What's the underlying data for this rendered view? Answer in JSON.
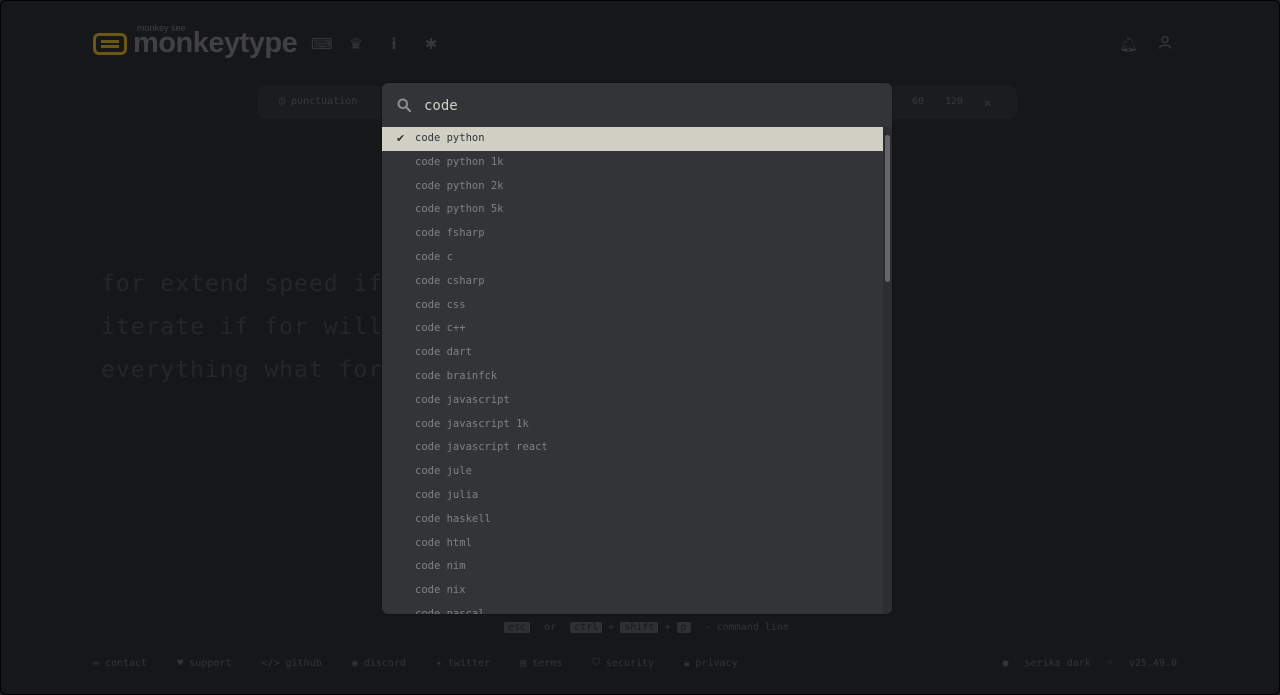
{
  "header": {
    "logo_top": "monkey see",
    "logo_text": "monkeytype",
    "icons": [
      "keyboard-icon",
      "crown-icon",
      "info-icon",
      "gear-icon",
      "bell-icon",
      "user-icon"
    ]
  },
  "config_bar": {
    "punctuation": "punctuation",
    "time_60": "60",
    "time_120": "120"
  },
  "background_words": [
    "for extend speed if be function for something does",
    "iterate if for will else do",
    "everything what for or if have else under"
  ],
  "command_line": {
    "query": "code",
    "selected_index": 0,
    "items": [
      "code python",
      "code python 1k",
      "code python 2k",
      "code python 5k",
      "code fsharp",
      "code c",
      "code csharp",
      "code css",
      "code c++",
      "code dart",
      "code brainfck",
      "code javascript",
      "code javascript 1k",
      "code javascript react",
      "code jule",
      "code julia",
      "code haskell",
      "code html",
      "code nim",
      "code nix",
      "code pascal"
    ]
  },
  "hint": {
    "esc": "esc",
    "or": "or",
    "ctrl": "ctrl",
    "shift": "shift",
    "p": "p",
    "label": "- command line"
  },
  "footer": {
    "links": [
      "contact",
      "support",
      "github",
      "discord",
      "twitter",
      "terms",
      "security",
      "privacy"
    ],
    "theme": "serika dark",
    "version": "v25.49.0"
  },
  "colors": {
    "background": "#323437",
    "main": "#e2b714",
    "text": "#d1d0c5",
    "sub": "#646669"
  }
}
